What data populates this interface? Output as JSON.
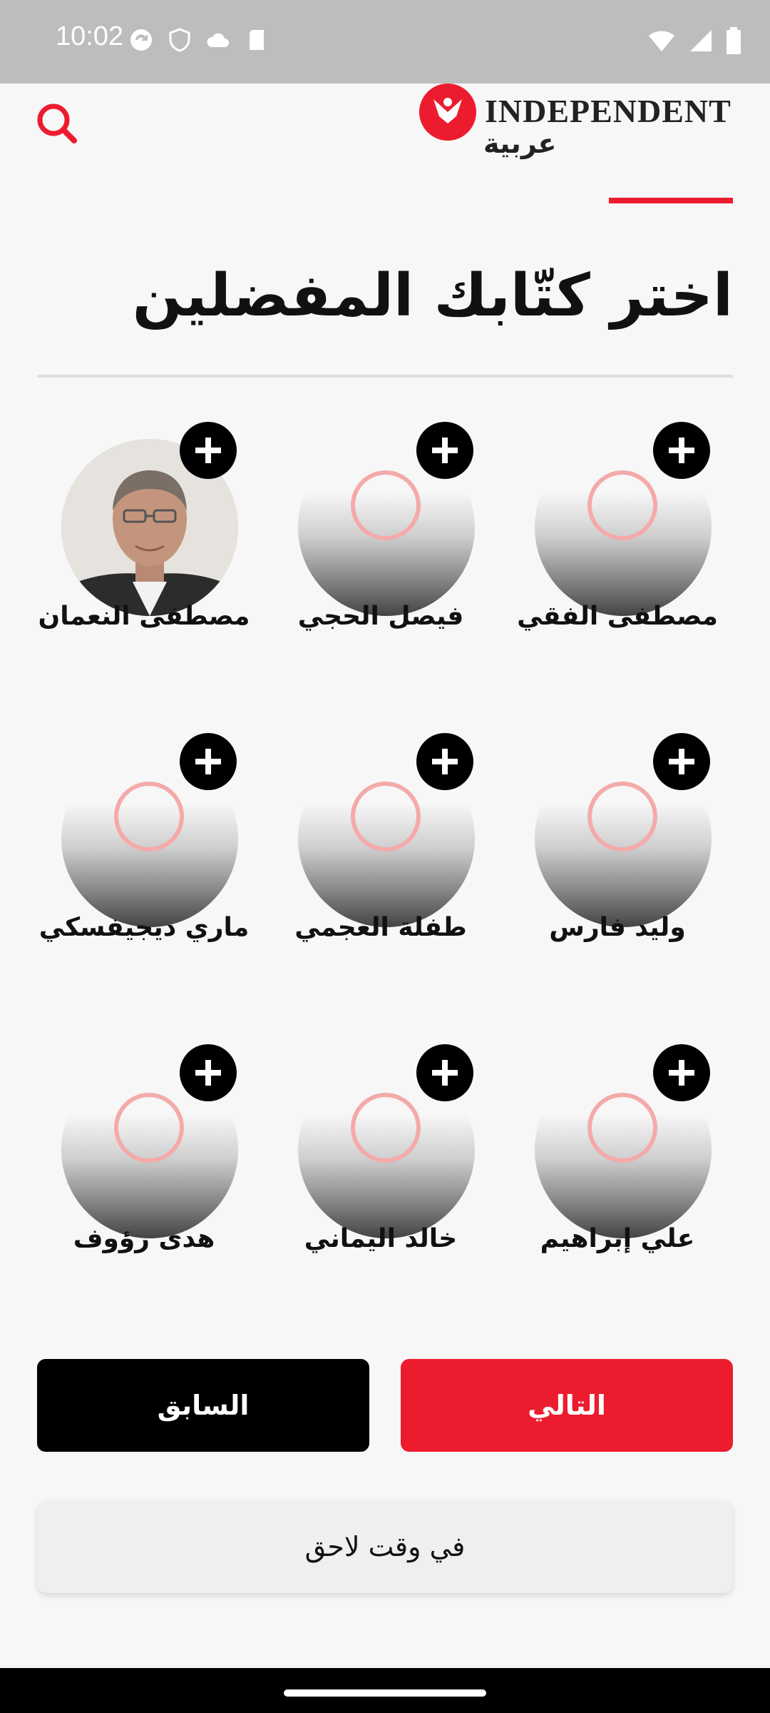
{
  "status_bar": {
    "time": "10:02",
    "left_icons": [
      "sync-icon",
      "shield-icon",
      "cloud-icon",
      "sd-card-icon"
    ],
    "right_icons": [
      "wifi-icon",
      "signal-icon",
      "battery-icon"
    ]
  },
  "header": {
    "logo_word": "INDEPENDENT",
    "logo_arabic": "عربية",
    "search_icon": "search-icon",
    "accent_color": "#ec1c2e"
  },
  "page": {
    "title": "اختر كتّابك المفضلين"
  },
  "writers": [
    {
      "name": "مصطفى النعمان",
      "has_photo": true
    },
    {
      "name": "فيصل الحجي",
      "has_photo": false
    },
    {
      "name": "مصطفى الفقي",
      "has_photo": false
    },
    {
      "name": "ماري ديجيفسكي",
      "has_photo": false
    },
    {
      "name": "طفلة العجمي",
      "has_photo": false
    },
    {
      "name": "وليد فارس",
      "has_photo": false
    },
    {
      "name": "هدى رؤوف",
      "has_photo": false
    },
    {
      "name": "خالد اليماني",
      "has_photo": false
    },
    {
      "name": "علي إبراهيم",
      "has_photo": false
    }
  ],
  "actions": {
    "previous_label": "السابق",
    "next_label": "التالي",
    "later_label": "في وقت لاحق"
  }
}
